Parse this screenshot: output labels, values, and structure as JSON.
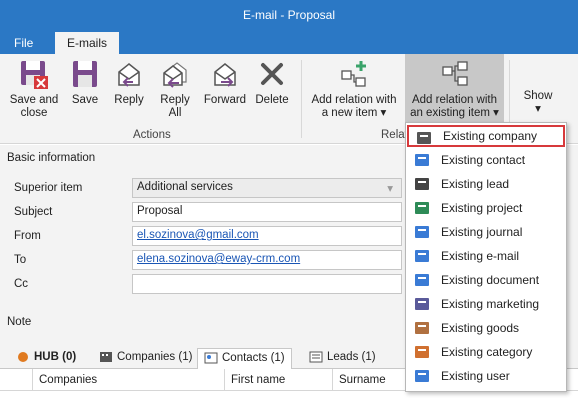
{
  "window": {
    "title": "E-mail - Proposal"
  },
  "ribbon_tabs": [
    "File",
    "E-mails"
  ],
  "ribbon": {
    "actions": [
      {
        "label": "Save and close",
        "icon": "save-close-icon"
      },
      {
        "label": "Save",
        "icon": "save-icon"
      },
      {
        "label": "Reply",
        "icon": "reply-icon"
      },
      {
        "label": "Reply All",
        "icon": "reply-all-icon"
      },
      {
        "label": "Forward",
        "icon": "forward-icon"
      },
      {
        "label": "Delete",
        "icon": "delete-icon"
      }
    ],
    "actions_group_label": "Actions",
    "relations": [
      {
        "label": "Add relation with a new item ▾",
        "icon": "add-relation-new-icon"
      },
      {
        "label": "Add relation with an existing item ▾",
        "icon": "add-relation-existing-icon"
      }
    ],
    "relations_group_label": "Relat",
    "show_label": "Show ▾"
  },
  "form": {
    "section_title": "Basic information",
    "superior_item": {
      "label": "Superior item",
      "value": "Additional services"
    },
    "subject": {
      "label": "Subject",
      "value": "Proposal"
    },
    "from": {
      "label": "From",
      "value": "el.sozinova@gmail.com"
    },
    "to": {
      "label": "To",
      "value": "elena.sozinova@eway-crm.com"
    },
    "cc": {
      "label": "Cc",
      "value": ""
    },
    "note_label": "Note"
  },
  "bottom_tabs": [
    {
      "label": "HUB (0)",
      "icon": "hub-icon"
    },
    {
      "label": "Companies (1)",
      "icon": "companies-icon"
    },
    {
      "label": "Contacts (1)",
      "icon": "contacts-icon",
      "active": true
    },
    {
      "label": "Leads (1)",
      "icon": "leads-icon"
    }
  ],
  "grid_columns": [
    "Companies",
    "First name",
    "Surname"
  ],
  "dropdown": {
    "selected_index": 0,
    "items": [
      {
        "label": "Existing company",
        "icon": "company-icon",
        "color": "#555555"
      },
      {
        "label": "Existing contact",
        "icon": "contact-icon",
        "color": "#3a7bd5"
      },
      {
        "label": "Existing lead",
        "icon": "lead-icon",
        "color": "#444444"
      },
      {
        "label": "Existing project",
        "icon": "project-icon",
        "color": "#2e8b57"
      },
      {
        "label": "Existing journal",
        "icon": "journal-icon",
        "color": "#3a7bd5"
      },
      {
        "label": "Existing e-mail",
        "icon": "email-icon",
        "color": "#3a7bd5"
      },
      {
        "label": "Existing document",
        "icon": "document-icon",
        "color": "#3a7bd5"
      },
      {
        "label": "Existing marketing",
        "icon": "marketing-icon",
        "color": "#5a5a9a"
      },
      {
        "label": "Existing goods",
        "icon": "goods-icon",
        "color": "#b07040"
      },
      {
        "label": "Existing category",
        "icon": "category-icon",
        "color": "#d07030"
      },
      {
        "label": "Existing user",
        "icon": "user-icon",
        "color": "#3a7bd5"
      }
    ]
  }
}
